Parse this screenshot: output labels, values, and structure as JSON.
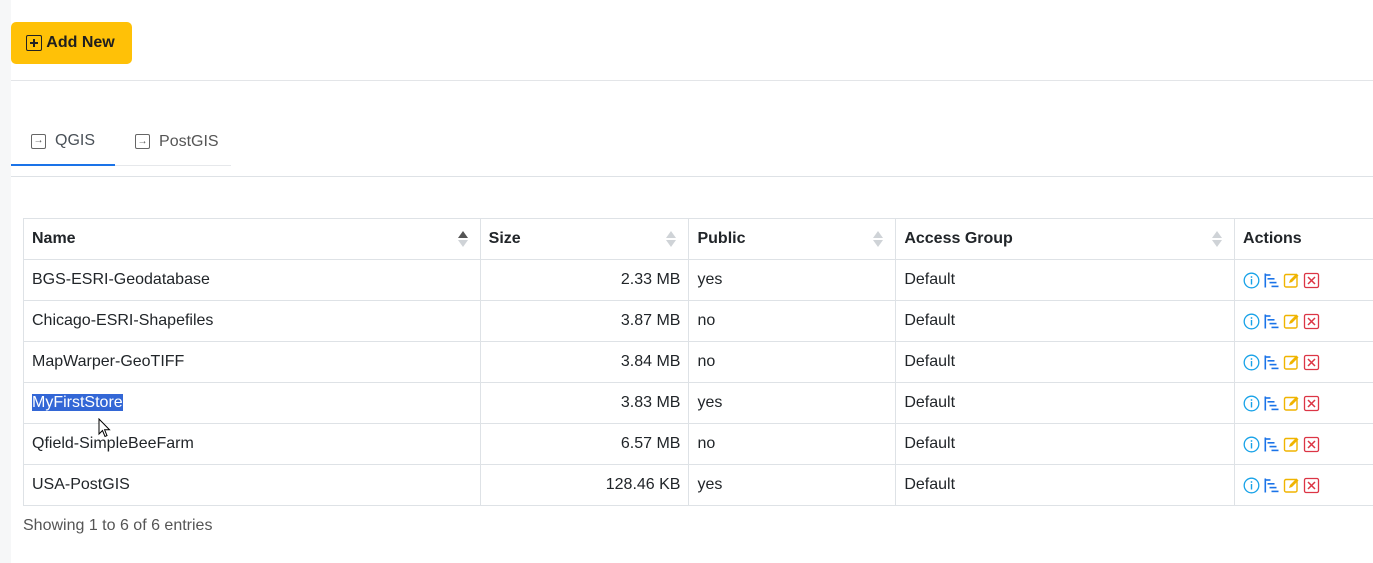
{
  "toolbar": {
    "add_label": "Add New"
  },
  "tabs": [
    {
      "label": "QGIS",
      "active": true
    },
    {
      "label": "PostGIS",
      "active": false
    }
  ],
  "table": {
    "columns": [
      "Name",
      "Size",
      "Public",
      "Access Group",
      "Actions"
    ],
    "rows": [
      {
        "name": "BGS-ESRI-Geodatabase",
        "size": "2.33 MB",
        "public": "yes",
        "group": "Default"
      },
      {
        "name": "Chicago-ESRI-Shapefiles",
        "size": "3.87 MB",
        "public": "no",
        "group": "Default"
      },
      {
        "name": "MapWarper-GeoTIFF",
        "size": "3.84 MB",
        "public": "no",
        "group": "Default"
      },
      {
        "name": "MyFirstStore",
        "size": "3.83 MB",
        "public": "yes",
        "group": "Default"
      },
      {
        "name": "Qfield-SimpleBeeFarm",
        "size": "6.57 MB",
        "public": "no",
        "group": "Default"
      },
      {
        "name": "USA-PostGIS",
        "size": "128.46 KB",
        "public": "yes",
        "group": "Default"
      }
    ],
    "selected_row": 3
  },
  "footer": {
    "info": "Showing 1 to 6 of 6 entries"
  },
  "colors": {
    "accent": "#ffc107",
    "tab_active": "#1a73e8",
    "info_icon": "#17a2e8",
    "tree_icon": "#1a73e8",
    "edit_icon": "#f0b400",
    "delete_icon": "#dc3545",
    "selection": "#3367d6"
  },
  "icons": {
    "add": "plus-square-icon",
    "tab": "box-arrow-in-right-icon",
    "actions": [
      "info-icon",
      "tree-icon",
      "edit-icon",
      "delete-icon"
    ]
  }
}
